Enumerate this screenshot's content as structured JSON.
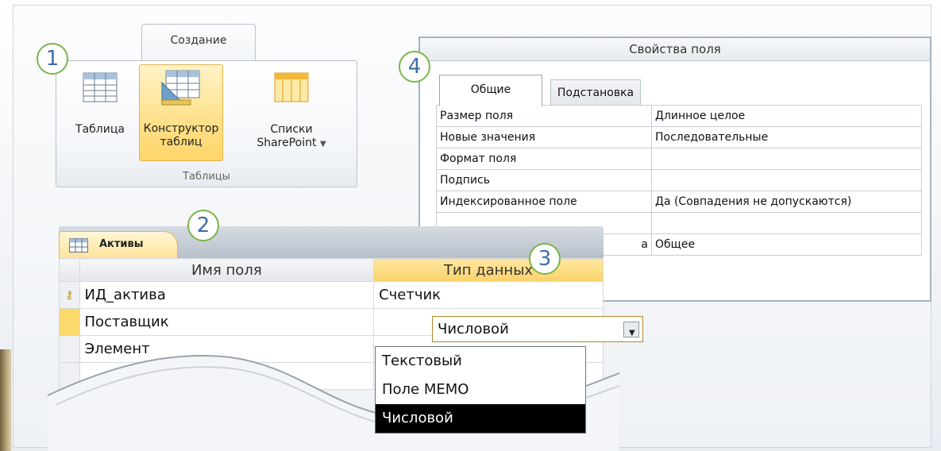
{
  "ribbon": {
    "tab_label": "Создание",
    "buttons": [
      {
        "line1": "Таблица",
        "line2": ""
      },
      {
        "line1": "Конструктор",
        "line2": "таблиц"
      },
      {
        "line1": "Списки",
        "line2": "SharePoint"
      }
    ],
    "group_label": "Таблицы",
    "icons": [
      "table-icon",
      "table-design-icon",
      "sharepoint-list-icon",
      "dropdown-arrow-icon"
    ]
  },
  "callouts": [
    "1",
    "2",
    "3",
    "4"
  ],
  "properties": {
    "title": "Свойства поля",
    "tabs": [
      "Общие",
      "Подстановка"
    ],
    "rows": [
      {
        "key": "Размер поля",
        "value": "Длинное целое"
      },
      {
        "key": "Новые значения",
        "value": "Последовательные"
      },
      {
        "key": "Формат поля",
        "value": ""
      },
      {
        "key": "Подпись",
        "value": ""
      },
      {
        "key": "Индексированное поле",
        "value": "Да (Совпадения не допускаются)"
      },
      {
        "key": "",
        "value": ""
      },
      {
        "key": "а",
        "value": "Общее"
      }
    ]
  },
  "design": {
    "table_name": "Активы",
    "col_field": "Имя поля",
    "col_type": "Тип данных",
    "rows": [
      {
        "field": "ИД_актива",
        "type": "Счетчик",
        "key": true
      },
      {
        "field": "Поставщик",
        "type": "Числовой",
        "key": false
      },
      {
        "field": "Элемент",
        "type": "",
        "key": false
      }
    ],
    "dropdown": {
      "options": [
        "Текстовый",
        "Поле MEMO",
        "Числовой"
      ],
      "highlighted": "Числовой"
    }
  },
  "colors": {
    "accent_orange": "#ffd56a",
    "callout_green": "#7ab648",
    "callout_text": "#3e6fa5"
  }
}
